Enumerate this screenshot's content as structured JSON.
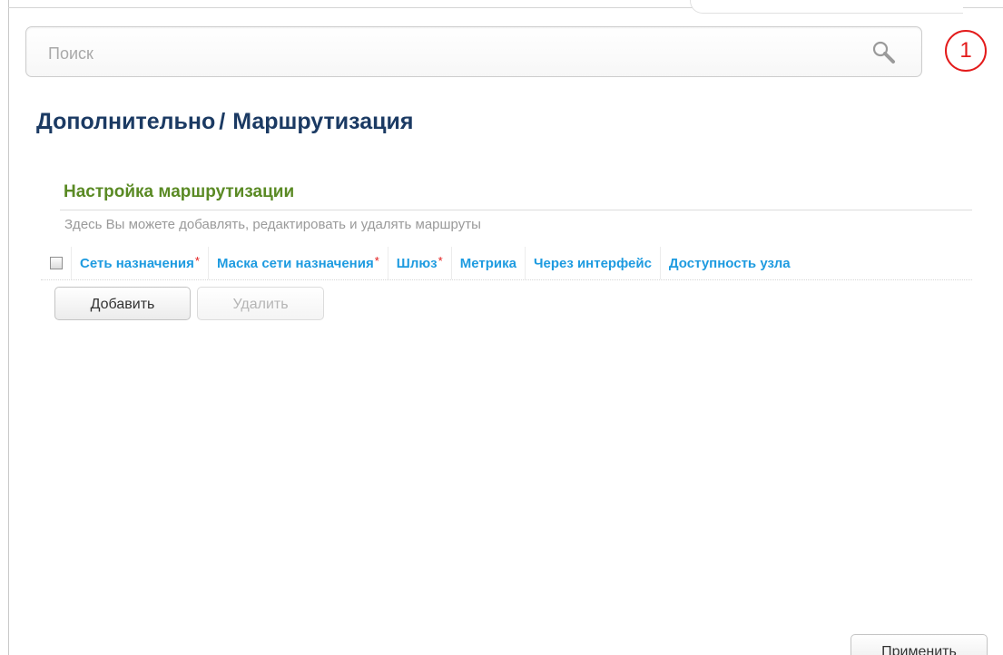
{
  "search": {
    "placeholder": "Поиск",
    "value": "",
    "icon": "search-icon"
  },
  "notifications": {
    "count": "1",
    "color": "#e31b1b"
  },
  "breadcrumb": {
    "parent": "Дополнительно",
    "separator": "/",
    "current": "Маршрутизация"
  },
  "section": {
    "title": "Настройка маршрутизации",
    "description": "Здесь Вы можете добавлять, редактировать и удалять маршруты"
  },
  "table": {
    "columns": [
      {
        "label": "Сеть назначения",
        "required": "*"
      },
      {
        "label": "Маска сети назначения",
        "required": "*"
      },
      {
        "label": "Шлюз",
        "required": "*"
      },
      {
        "label": "Метрика",
        "required": ""
      },
      {
        "label": "Через интерфейс",
        "required": ""
      },
      {
        "label": "Доступность узла",
        "required": ""
      }
    ],
    "rows": []
  },
  "buttons": {
    "add": "Добавить",
    "delete": "Удалить",
    "apply": "Применить"
  },
  "colors": {
    "title": "#1b3a63",
    "section_title": "#5a8a24",
    "column_header": "#1e9be0",
    "required_mark": "#e31b1b"
  }
}
